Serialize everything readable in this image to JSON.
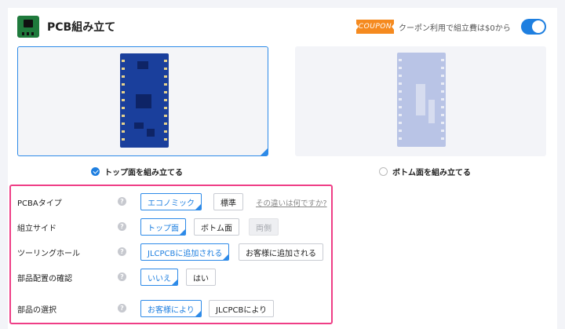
{
  "header": {
    "title": "PCB組み立て",
    "coupon_badge": "COUPON",
    "coupon_text": "クーポン利用で組立費は$0から",
    "toggle_on": true
  },
  "assembly_side": {
    "top_label": "トップ面を組み立てる",
    "bottom_label": "ボトム面を組み立てる",
    "selected": "top"
  },
  "options": {
    "pcba_type": {
      "label": "PCBAタイプ",
      "choices": [
        "エコノミック",
        "標準"
      ],
      "selected": "エコノミック",
      "help_link": "その違いは何ですか?"
    },
    "assembly_side": {
      "label": "組立サイド",
      "choices": [
        "トップ面",
        "ボトム面",
        "両側"
      ],
      "selected": "トップ面",
      "disabled": "両側"
    },
    "tooling_holes": {
      "label": "ツーリングホール",
      "choices": [
        "JLCPCBに追加される",
        "お客様に追加される"
      ],
      "selected": "JLCPCBに追加される"
    },
    "placement_confirm": {
      "label": "部品配置の確認",
      "choices": [
        "いいえ",
        "はい"
      ],
      "selected": "いいえ"
    },
    "parts_selection": {
      "label": "部品の選択",
      "choices": [
        "お客様により",
        "JLCPCBにより"
      ],
      "selected": "お客様により"
    }
  },
  "help_icon": "question-icon",
  "colors": {
    "accent": "#1e7fe0",
    "highlight_border": "#ef3e86",
    "coupon": "#f58a1f",
    "pcb_top": "#1a3f9c"
  }
}
